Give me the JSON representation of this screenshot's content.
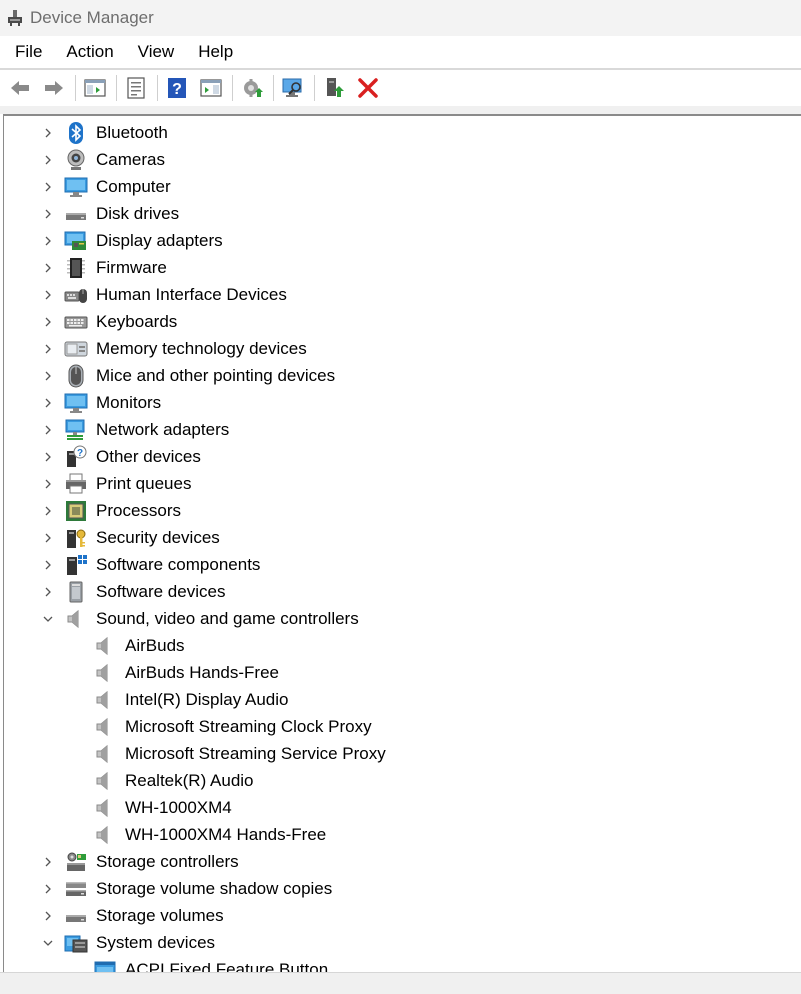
{
  "window": {
    "title": "Device Manager",
    "app_icon": "device-manager-icon"
  },
  "menu": {
    "items": [
      "File",
      "Action",
      "View",
      "Help"
    ]
  },
  "toolbar": {
    "buttons": [
      "back-arrow-icon",
      "forward-arrow-icon",
      "show-hide-console-tree-icon",
      "properties-icon",
      "help-icon",
      "show-action-pane-icon",
      "update-driver-icon",
      "scan-hardware-icon",
      "enable-device-icon",
      "uninstall-device-icon"
    ]
  },
  "tree": {
    "nodes": [
      {
        "label": "Bluetooth",
        "icon": "bluetooth-icon",
        "level": 0,
        "expanded": false
      },
      {
        "label": "Cameras",
        "icon": "camera-icon",
        "level": 0,
        "expanded": false
      },
      {
        "label": "Computer",
        "icon": "computer-icon",
        "level": 0,
        "expanded": false
      },
      {
        "label": "Disk drives",
        "icon": "disk-drive-icon",
        "level": 0,
        "expanded": false
      },
      {
        "label": "Display adapters",
        "icon": "display-adapter-icon",
        "level": 0,
        "expanded": false
      },
      {
        "label": "Firmware",
        "icon": "firmware-icon",
        "level": 0,
        "expanded": false
      },
      {
        "label": "Human Interface Devices",
        "icon": "hid-icon",
        "level": 0,
        "expanded": false
      },
      {
        "label": "Keyboards",
        "icon": "keyboard-icon",
        "level": 0,
        "expanded": false
      },
      {
        "label": "Memory technology devices",
        "icon": "memory-device-icon",
        "level": 0,
        "expanded": false
      },
      {
        "label": "Mice and other pointing devices",
        "icon": "mouse-icon",
        "level": 0,
        "expanded": false
      },
      {
        "label": "Monitors",
        "icon": "monitor-icon",
        "level": 0,
        "expanded": false
      },
      {
        "label": "Network adapters",
        "icon": "network-adapter-icon",
        "level": 0,
        "expanded": false
      },
      {
        "label": "Other devices",
        "icon": "other-devices-icon",
        "level": 0,
        "expanded": false
      },
      {
        "label": "Print queues",
        "icon": "printer-icon",
        "level": 0,
        "expanded": false
      },
      {
        "label": "Processors",
        "icon": "processor-icon",
        "level": 0,
        "expanded": false
      },
      {
        "label": "Security devices",
        "icon": "security-device-icon",
        "level": 0,
        "expanded": false
      },
      {
        "label": "Software components",
        "icon": "software-component-icon",
        "level": 0,
        "expanded": false
      },
      {
        "label": "Software devices",
        "icon": "software-device-icon",
        "level": 0,
        "expanded": false
      },
      {
        "label": "Sound, video and game controllers",
        "icon": "speaker-icon",
        "level": 0,
        "expanded": true
      },
      {
        "label": "AirBuds",
        "icon": "speaker-icon",
        "level": 1
      },
      {
        "label": "AirBuds Hands-Free",
        "icon": "speaker-icon",
        "level": 1
      },
      {
        "label": "Intel(R) Display Audio",
        "icon": "speaker-icon",
        "level": 1
      },
      {
        "label": "Microsoft Streaming Clock Proxy",
        "icon": "speaker-icon",
        "level": 1
      },
      {
        "label": "Microsoft Streaming Service Proxy",
        "icon": "speaker-icon",
        "level": 1
      },
      {
        "label": "Realtek(R) Audio",
        "icon": "speaker-icon",
        "level": 1
      },
      {
        "label": "WH-1000XM4",
        "icon": "speaker-icon",
        "level": 1
      },
      {
        "label": "WH-1000XM4 Hands-Free",
        "icon": "speaker-icon",
        "level": 1
      },
      {
        "label": "Storage controllers",
        "icon": "storage-controller-icon",
        "level": 0,
        "expanded": false
      },
      {
        "label": "Storage volume shadow copies",
        "icon": "shadow-copy-icon",
        "level": 0,
        "expanded": false
      },
      {
        "label": "Storage volumes",
        "icon": "storage-volume-icon",
        "level": 0,
        "expanded": false
      },
      {
        "label": "System devices",
        "icon": "system-devices-icon",
        "level": 0,
        "expanded": true
      },
      {
        "label": "ACPI Fixed Feature Button",
        "icon": "system-device-item-icon",
        "level": 1
      }
    ]
  },
  "colors": {
    "accent_blue": "#1e73c9",
    "delete_red": "#d92020",
    "update_green": "#2e9c3a"
  }
}
